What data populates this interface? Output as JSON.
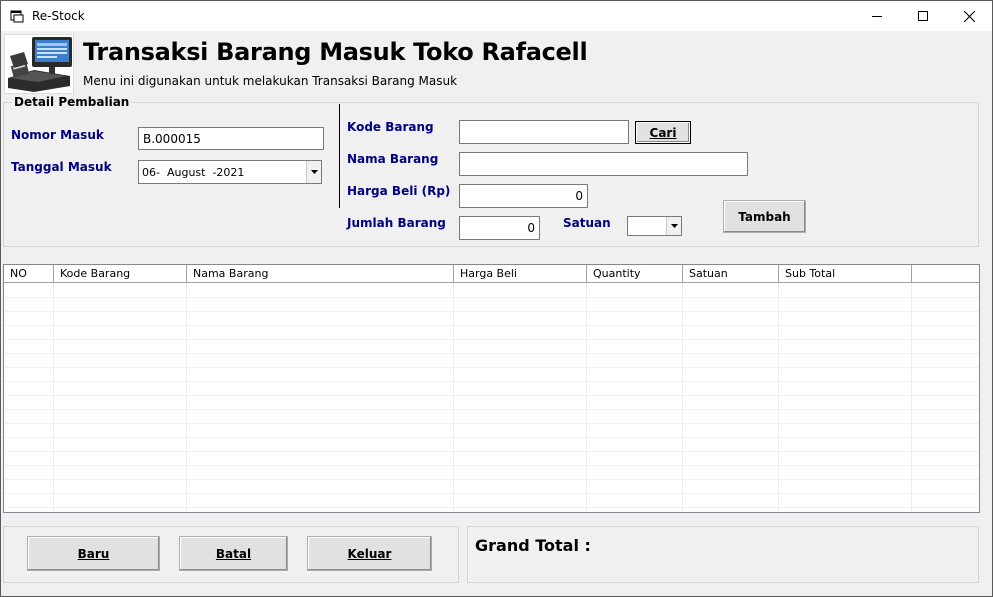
{
  "window": {
    "title": "Re-Stock"
  },
  "header": {
    "title": "Transaksi Barang Masuk Toko Rafacell",
    "subtitle": "Menu ini digunakan untuk melakukan Transaksi Barang Masuk"
  },
  "detail": {
    "group_label": "Detail Pembalian",
    "nomor_label": "Nomor  Masuk",
    "nomor_value": "B.000015",
    "tanggal_label": "Tanggal Masuk",
    "tanggal_value": "06-  August  -2021"
  },
  "item": {
    "kode_label": "Kode Barang",
    "kode_value": "",
    "cari_label": "Cari",
    "nama_label": "Nama Barang",
    "nama_value": "",
    "harga_label": "Harga Beli (Rp)",
    "harga_value": "0",
    "jumlah_label": "Jumlah Barang",
    "jumlah_value": "0",
    "satuan_label": "Satuan",
    "satuan_value": "",
    "tambah_label": "Tambah"
  },
  "table": {
    "columns": [
      "NO",
      "Kode Barang",
      "Nama Barang",
      "Harga Beli",
      "Quantity",
      "Satuan",
      "Sub Total"
    ],
    "rows": []
  },
  "actions": {
    "baru_label": "Baru",
    "batal_label": "Batal",
    "keluar_label": "Keluar"
  },
  "summary": {
    "grand_total_label": "Grand Total :"
  },
  "icons": {
    "app": "app-window-icon",
    "minimize": "minimize-icon",
    "maximize": "maximize-icon",
    "close": "close-icon",
    "logo": "cash-register-icon",
    "dropdown": "chevron-down-icon"
  }
}
